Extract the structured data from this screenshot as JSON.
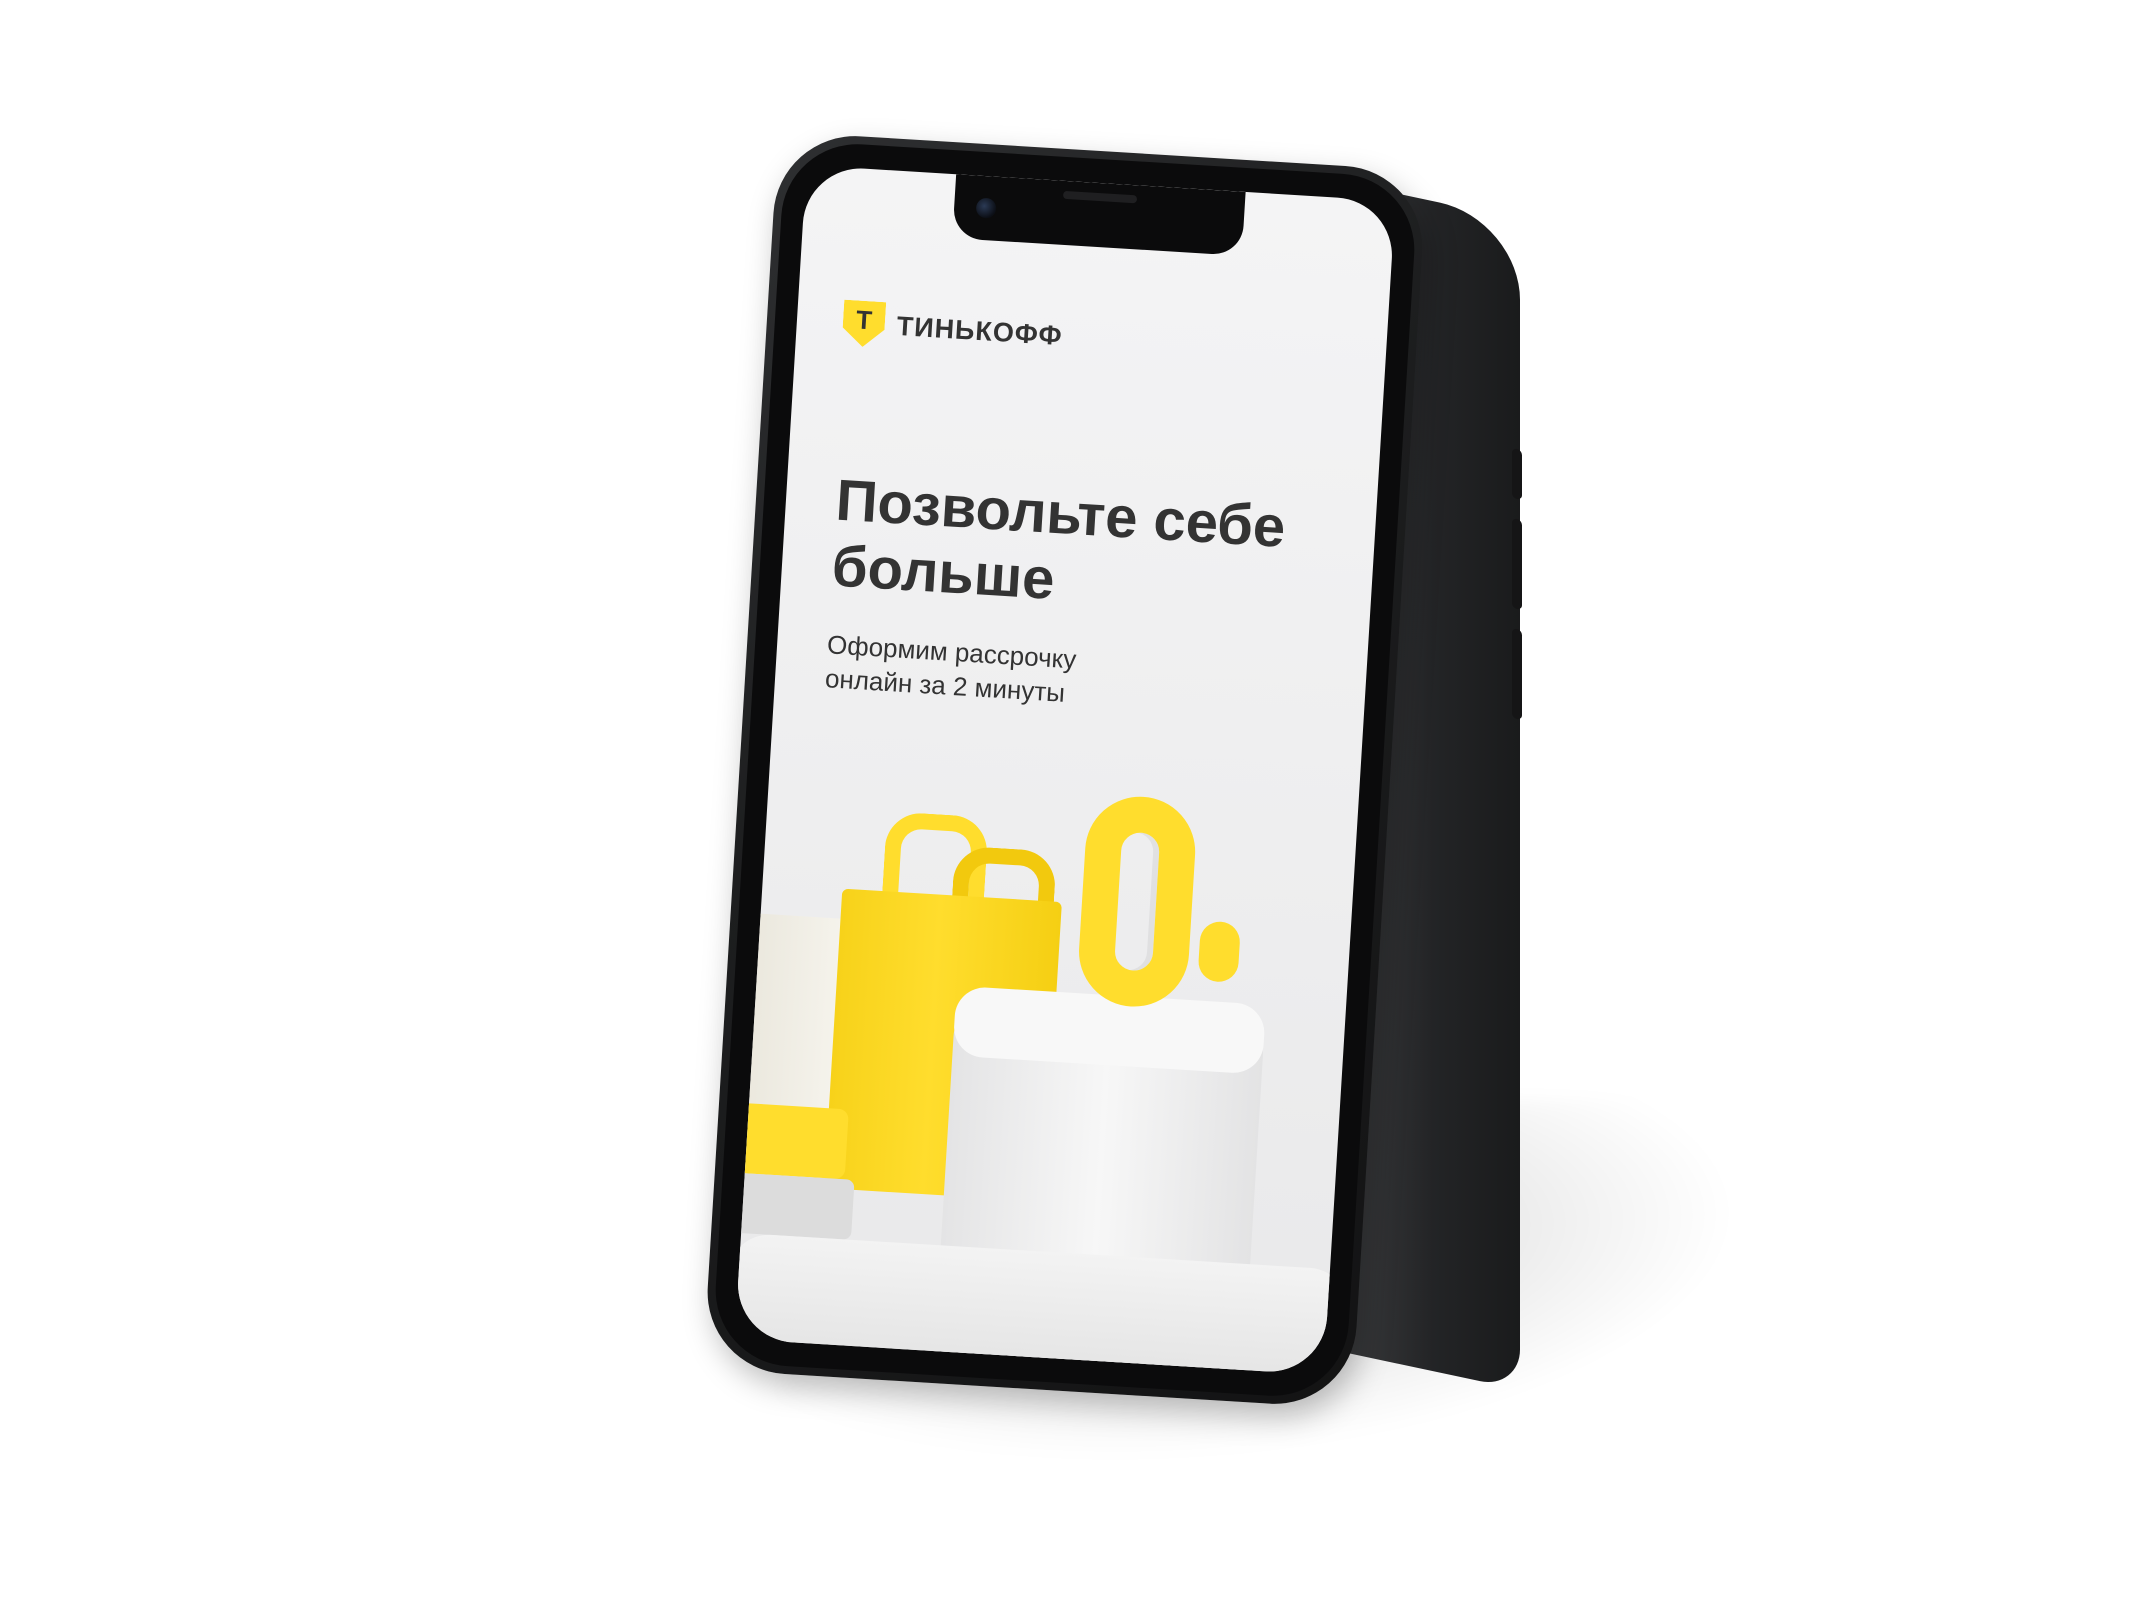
{
  "brand": {
    "name": "ТИНЬКОФФ",
    "logo_letter": "Т",
    "accent_color": "#ffdd2d",
    "text_color": "#333333"
  },
  "promo": {
    "headline_line1": "Позвольте себе",
    "headline_line2": "больше",
    "subtitle_line1": "Оформим рассрочку",
    "subtitle_line2": "онлайн за 2 минуты"
  },
  "device": {
    "icons": [
      "camera-icon",
      "speaker-grille"
    ]
  },
  "illustration": {
    "items": [
      "shopping-bag-icon",
      "zero-percent-icon",
      "pedestal",
      "gift-box"
    ]
  }
}
